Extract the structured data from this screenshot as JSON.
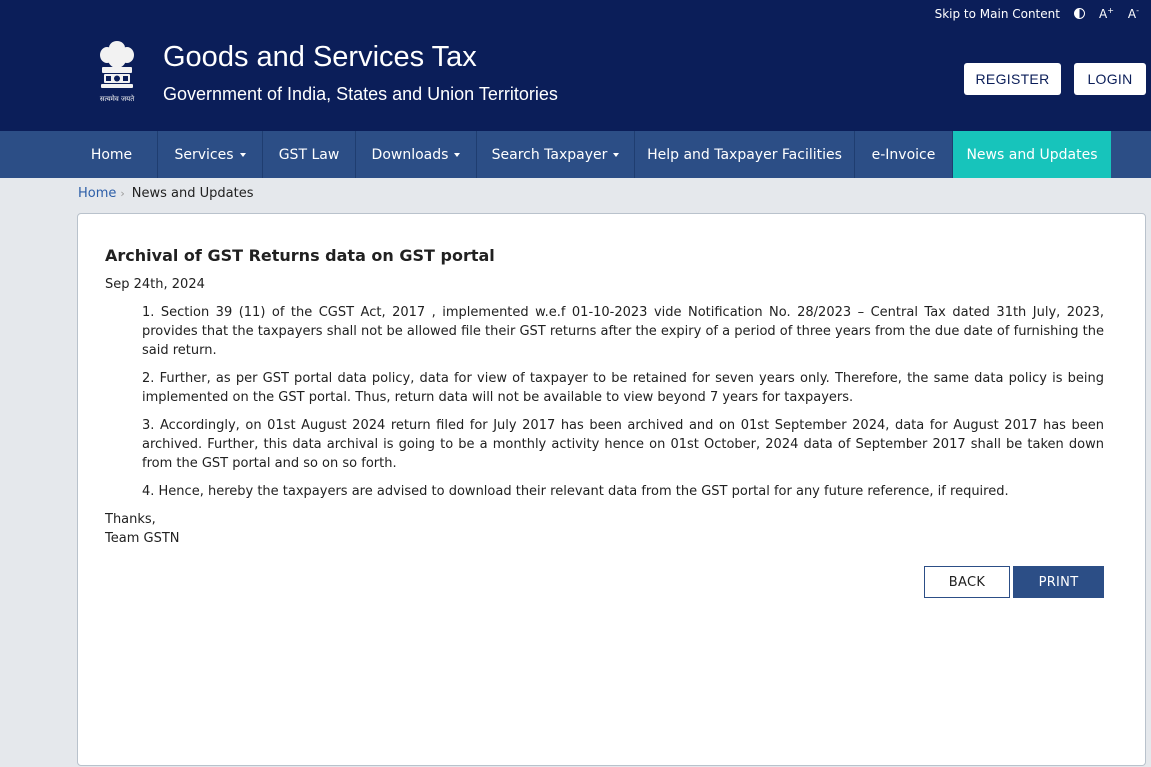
{
  "topbar": {
    "skip_label": "Skip to Main Content",
    "font_increase": "A",
    "font_increase_sup": "+",
    "font_decrease": "A",
    "font_decrease_sup": "-"
  },
  "header": {
    "emblem_caption": "सत्यमेव जयते",
    "title": "Goods and Services Tax",
    "subtitle": "Government of India, States and Union Territories",
    "register_label": "REGISTER",
    "login_label": "LOGIN"
  },
  "nav": {
    "items": [
      {
        "label": "Home",
        "dropdown": false
      },
      {
        "label": "Services",
        "dropdown": true
      },
      {
        "label": "GST Law",
        "dropdown": false
      },
      {
        "label": "Downloads",
        "dropdown": true
      },
      {
        "label": "Search Taxpayer",
        "dropdown": true
      },
      {
        "label": "Help and Taxpayer Facilities",
        "dropdown": false
      },
      {
        "label": "e-Invoice",
        "dropdown": false
      },
      {
        "label": "News and Updates",
        "dropdown": false,
        "active": true
      }
    ]
  },
  "breadcrumb": {
    "home": "Home",
    "separator": "›",
    "current": "News and Updates"
  },
  "article": {
    "title": "Archival of GST Returns data on GST portal",
    "date": "Sep 24th, 2024",
    "points": [
      "1.  Section 39 (11) of the CGST Act, 2017 , implemented w.e.f 01-10-2023 vide Notification No. 28/2023 – Central Tax dated 31th July, 2023, provides that the taxpayers shall not be allowed file their GST returns after the expiry of a period of three years from the due date of furnishing the said return.",
      "2.  Further, as per GST portal data policy, data for view of taxpayer to be retained for seven years only. Therefore, the same data policy is being implemented on the GST portal. Thus, return data will not be available to view beyond 7 years for taxpayers.",
      "3.  Accordingly, on 01st August 2024 return filed for July 2017 has been archived and on 01st September 2024, data for August 2017 has been archived. Further, this data archival is going to be a monthly activity hence on 01st October, 2024 data of September 2017 shall be taken down from the GST portal and so on so forth.",
      "4.  Hence, hereby the taxpayers are advised to download their relevant data from the GST portal for any future reference, if required."
    ],
    "thanks": "Thanks,",
    "signature": "Team GSTN",
    "back_label": "BACK",
    "print_label": "PRINT"
  },
  "colors": {
    "header_bg": "#0b1e59",
    "nav_bg": "#2c4e86",
    "nav_active": "#17c4bb",
    "page_bg": "#e5e8ec"
  }
}
